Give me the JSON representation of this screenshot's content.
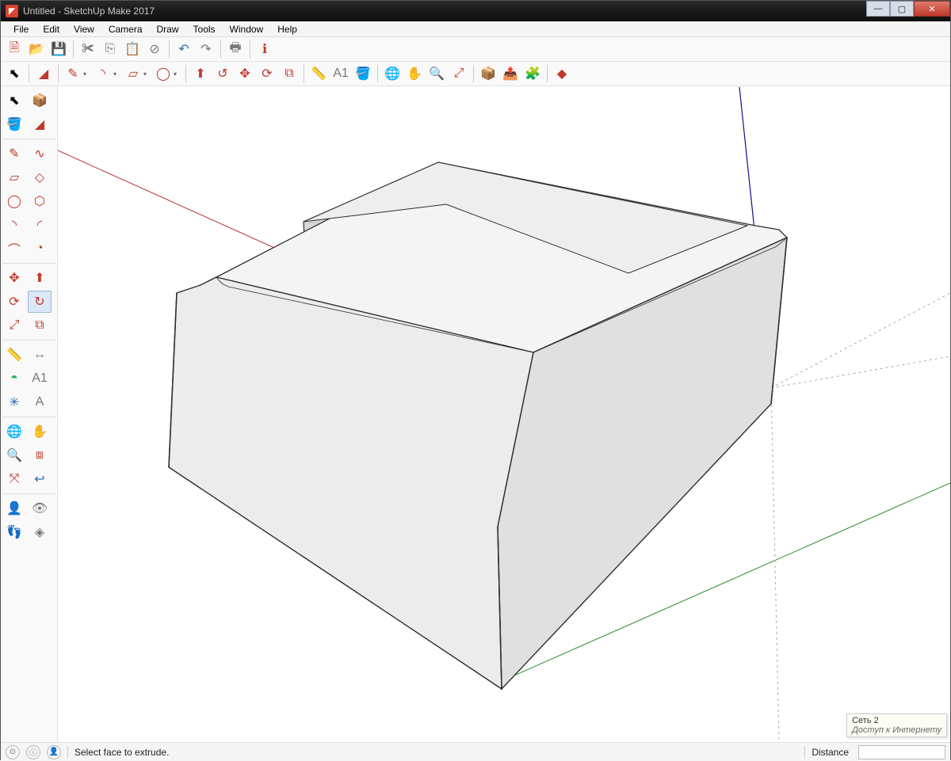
{
  "window": {
    "title": "Untitled - SketchUp Make 2017"
  },
  "menu": {
    "items": [
      "File",
      "Edit",
      "View",
      "Camera",
      "Draw",
      "Tools",
      "Window",
      "Help"
    ]
  },
  "toolbar1": [
    {
      "name": "new-from-template",
      "glyph": "🗎",
      "cls": "ic-red"
    },
    {
      "name": "open",
      "glyph": "📂",
      "cls": "ic-yellow"
    },
    {
      "name": "save",
      "glyph": "💾",
      "cls": "ic-blue"
    },
    {
      "name": "sep"
    },
    {
      "name": "cut",
      "glyph": "✀",
      "cls": "ic-gray"
    },
    {
      "name": "copy",
      "glyph": "⎘",
      "cls": "ic-gray"
    },
    {
      "name": "paste",
      "glyph": "📋",
      "cls": "ic-gray"
    },
    {
      "name": "delete",
      "glyph": "⊘",
      "cls": "ic-gray"
    },
    {
      "name": "sep"
    },
    {
      "name": "undo",
      "glyph": "↶",
      "cls": "ic-blue"
    },
    {
      "name": "redo",
      "glyph": "↷",
      "cls": "ic-gray"
    },
    {
      "name": "sep"
    },
    {
      "name": "print",
      "glyph": "🖶",
      "cls": "ic-gray"
    },
    {
      "name": "sep"
    },
    {
      "name": "model-info",
      "glyph": "ℹ",
      "cls": "ic-red"
    }
  ],
  "toolbar2": [
    {
      "name": "select",
      "glyph": "⬉",
      "cls": ""
    },
    {
      "name": "sep"
    },
    {
      "name": "eraser",
      "glyph": "◢",
      "cls": "ic-red"
    },
    {
      "name": "sep"
    },
    {
      "name": "line",
      "glyph": "✎",
      "cls": "ic-red",
      "dd": true
    },
    {
      "name": "arc",
      "glyph": "◝",
      "cls": "ic-red",
      "dd": true
    },
    {
      "name": "rectangle",
      "glyph": "▱",
      "cls": "ic-red",
      "dd": true
    },
    {
      "name": "circle",
      "glyph": "◯",
      "cls": "ic-red",
      "dd": true
    },
    {
      "name": "sep"
    },
    {
      "name": "push-pull",
      "glyph": "⬆",
      "cls": "ic-red"
    },
    {
      "name": "follow-me",
      "glyph": "↺",
      "cls": "ic-red"
    },
    {
      "name": "move",
      "glyph": "✥",
      "cls": "ic-red"
    },
    {
      "name": "rotate",
      "glyph": "⟳",
      "cls": "ic-red"
    },
    {
      "name": "offset",
      "glyph": "⧉",
      "cls": "ic-red"
    },
    {
      "name": "sep"
    },
    {
      "name": "tape-measure",
      "glyph": "📏",
      "cls": "ic-yellow"
    },
    {
      "name": "text",
      "glyph": "A1",
      "cls": "ic-gray"
    },
    {
      "name": "paint-bucket",
      "glyph": "🪣",
      "cls": "ic-yellow"
    },
    {
      "name": "sep"
    },
    {
      "name": "orbit",
      "glyph": "🌐",
      "cls": "ic-green"
    },
    {
      "name": "pan",
      "glyph": "✋",
      "cls": "ic-yellow"
    },
    {
      "name": "zoom",
      "glyph": "🔍",
      "cls": "ic-blue"
    },
    {
      "name": "zoom-extents",
      "glyph": "⤢",
      "cls": "ic-red"
    },
    {
      "name": "sep"
    },
    {
      "name": "warehouse-get",
      "glyph": "📦",
      "cls": "ic-yellow"
    },
    {
      "name": "warehouse-share",
      "glyph": "📤",
      "cls": "ic-yellow"
    },
    {
      "name": "extension-warehouse",
      "glyph": "🧩",
      "cls": "ic-gray"
    },
    {
      "name": "sep"
    },
    {
      "name": "layout",
      "glyph": "◆",
      "cls": "ic-red"
    }
  ],
  "sidetools": [
    [
      {
        "name": "select",
        "glyph": "⬉"
      },
      {
        "name": "component",
        "glyph": "📦",
        "cls": "ic-gray"
      }
    ],
    [
      {
        "name": "paint-bucket",
        "glyph": "🪣",
        "cls": "ic-yellow"
      },
      {
        "name": "eraser",
        "glyph": "◢",
        "cls": "ic-red"
      }
    ],
    "hr",
    [
      {
        "name": "line",
        "glyph": "✎",
        "cls": "ic-red"
      },
      {
        "name": "freehand",
        "glyph": "∿",
        "cls": "ic-red"
      }
    ],
    [
      {
        "name": "rectangle",
        "glyph": "▱",
        "cls": "ic-red"
      },
      {
        "name": "rotated-rect",
        "glyph": "◇",
        "cls": "ic-red"
      }
    ],
    [
      {
        "name": "circle",
        "glyph": "◯",
        "cls": "ic-red"
      },
      {
        "name": "polygon",
        "glyph": "⬡",
        "cls": "ic-red"
      }
    ],
    [
      {
        "name": "arc",
        "glyph": "◝",
        "cls": "ic-red"
      },
      {
        "name": "arc-2pt",
        "glyph": "◜",
        "cls": "ic-red"
      }
    ],
    [
      {
        "name": "arc-3pt",
        "glyph": "⌒",
        "cls": "ic-red"
      },
      {
        "name": "pie",
        "glyph": "◔",
        "cls": "ic-red"
      }
    ],
    "hr",
    [
      {
        "name": "move",
        "glyph": "✥",
        "cls": "ic-red"
      },
      {
        "name": "push-pull",
        "glyph": "⬆",
        "cls": "ic-red"
      }
    ],
    [
      {
        "name": "rotate",
        "glyph": "⟳",
        "cls": "ic-red"
      },
      {
        "name": "follow-me",
        "glyph": "↻",
        "cls": "ic-red",
        "active": true
      }
    ],
    [
      {
        "name": "scale",
        "glyph": "⤢",
        "cls": "ic-red"
      },
      {
        "name": "offset",
        "glyph": "⧉",
        "cls": "ic-red"
      }
    ],
    "hr",
    [
      {
        "name": "tape-measure",
        "glyph": "📏",
        "cls": "ic-yellow"
      },
      {
        "name": "dimension",
        "glyph": "↔",
        "cls": "ic-gray"
      }
    ],
    [
      {
        "name": "protractor",
        "glyph": "◓",
        "cls": "ic-green"
      },
      {
        "name": "text",
        "glyph": "A1",
        "cls": "ic-gray"
      }
    ],
    [
      {
        "name": "axes",
        "glyph": "✳",
        "cls": "ic-blue"
      },
      {
        "name": "3d-text",
        "glyph": "A",
        "cls": "ic-gray"
      }
    ],
    "hr",
    [
      {
        "name": "orbit",
        "glyph": "🌐",
        "cls": "ic-green"
      },
      {
        "name": "pan",
        "glyph": "✋",
        "cls": "ic-yellow"
      }
    ],
    [
      {
        "name": "zoom",
        "glyph": "🔍",
        "cls": "ic-blue"
      },
      {
        "name": "zoom-window",
        "glyph": "⧈",
        "cls": "ic-red"
      }
    ],
    [
      {
        "name": "zoom-extents",
        "glyph": "⤧",
        "cls": "ic-red"
      },
      {
        "name": "previous",
        "glyph": "↩",
        "cls": "ic-blue"
      }
    ],
    "hr",
    [
      {
        "name": "position-camera",
        "glyph": "👤",
        "cls": "ic-gray"
      },
      {
        "name": "look-around",
        "glyph": "👁",
        "cls": "ic-gray"
      }
    ],
    [
      {
        "name": "walk",
        "glyph": "👣",
        "cls": "ic-gray"
      },
      {
        "name": "section",
        "glyph": "◈",
        "cls": "ic-gray"
      }
    ]
  ],
  "status": {
    "hint": "Select face to extrude.",
    "distance_label": "Distance"
  },
  "nettip": {
    "line1": "Сеть 2",
    "line2": "Доступ к Интернету"
  }
}
